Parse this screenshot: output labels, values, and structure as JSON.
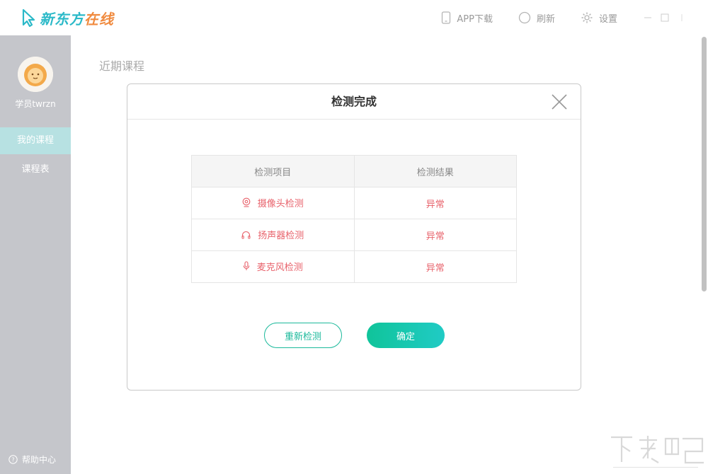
{
  "brand": {
    "name_part1": "新东方",
    "name_part2": "在线",
    "color_primary": "#2bb9c8",
    "color_secondary": "#f08a3e"
  },
  "toolbar": {
    "app_download": "APP下载",
    "refresh": "刷新",
    "settings": "设置"
  },
  "sidebar": {
    "user_name": "学员twrzn",
    "items": [
      {
        "label": "我的课程",
        "active": true
      },
      {
        "label": "课程表",
        "active": false
      }
    ],
    "help": "帮助中心"
  },
  "main": {
    "section_title": "近期课程"
  },
  "dialog": {
    "title": "检测完成",
    "columns": [
      "检测项目",
      "检测结果"
    ],
    "rows": [
      {
        "icon": "camera-icon",
        "item": "摄像头检测",
        "result": "异常"
      },
      {
        "icon": "headphones-icon",
        "item": "扬声器检测",
        "result": "异常"
      },
      {
        "icon": "microphone-icon",
        "item": "麦克风检测",
        "result": "异常"
      }
    ],
    "retry_label": "重新检测",
    "ok_label": "确定"
  },
  "colors": {
    "accent": "#1bb99b",
    "error": "#e8626b",
    "sidebar": "#c5c6cb",
    "sidebar_active": "#b7e1e2"
  }
}
